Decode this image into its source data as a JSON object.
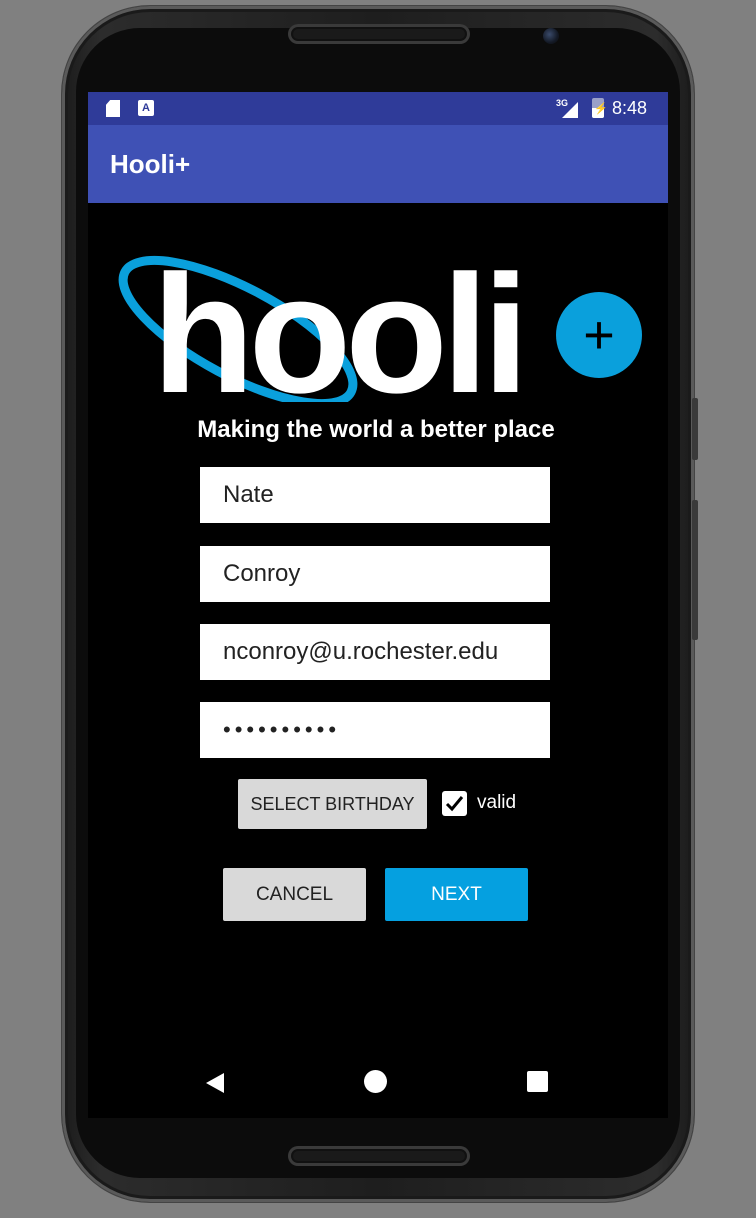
{
  "status_bar": {
    "time": "8:48",
    "network": "3G",
    "icons": [
      "sd-card-icon",
      "a-notification-icon",
      "signal-icon",
      "battery-charging-icon"
    ]
  },
  "app_bar": {
    "title": "Hooli+"
  },
  "logo": {
    "text": "hooli",
    "plus": "+",
    "accent_color": "#0aa0dc"
  },
  "tagline": "Making the world a better place",
  "form": {
    "first_name": "Nate",
    "last_name": "Conroy",
    "email": "nconroy@u.rochester.edu",
    "password": "••••••••••",
    "select_birthday_label": "SELECT BIRTHDAY",
    "valid_checked": true,
    "valid_label": "valid"
  },
  "actions": {
    "cancel_label": "CANCEL",
    "next_label": "NEXT"
  },
  "nav_bar": {
    "icons": [
      "back-icon",
      "home-icon",
      "recents-icon"
    ]
  },
  "colors": {
    "status_bar": "#2f3b99",
    "app_bar": "#3f51b5",
    "next_button": "#05a0e0",
    "secondary_button": "#d9d9d9"
  }
}
